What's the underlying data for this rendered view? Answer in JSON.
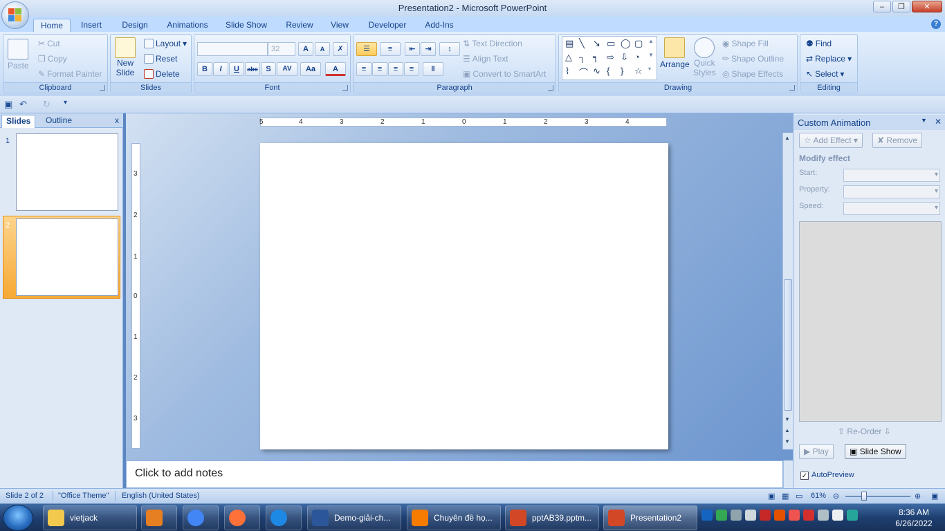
{
  "window": {
    "title": "Presentation2 - Microsoft PowerPoint"
  },
  "tabs": [
    {
      "label": "Home",
      "active": true
    },
    {
      "label": "Insert"
    },
    {
      "label": "Design"
    },
    {
      "label": "Animations"
    },
    {
      "label": "Slide Show"
    },
    {
      "label": "Review"
    },
    {
      "label": "View"
    },
    {
      "label": "Developer"
    },
    {
      "label": "Add-Ins"
    }
  ],
  "ribbon": {
    "clipboard": {
      "label": "Clipboard",
      "paste": "Paste",
      "cut": "Cut",
      "copy": "Copy",
      "format_painter": "Format Painter"
    },
    "slides": {
      "label": "Slides",
      "new_slide_1": "New",
      "new_slide_2": "Slide",
      "layout": "Layout",
      "reset": "Reset",
      "delete": "Delete"
    },
    "font": {
      "label": "Font",
      "size": "32",
      "bold": "B",
      "italic": "I",
      "underline": "U",
      "strike": "abc",
      "shadow": "S",
      "spacing": "AV",
      "case": "Aa",
      "color": "A"
    },
    "paragraph": {
      "label": "Paragraph",
      "text_direction": "Text Direction",
      "align_text": "Align Text",
      "convert_smartart": "Convert to SmartArt"
    },
    "drawing": {
      "label": "Drawing",
      "arrange": "Arrange",
      "quick_styles_1": "Quick",
      "quick_styles_2": "Styles",
      "shape_fill": "Shape Fill",
      "shape_outline": "Shape Outline",
      "shape_effects": "Shape Effects"
    },
    "editing": {
      "label": "Editing",
      "find": "Find",
      "replace": "Replace",
      "select": "Select"
    }
  },
  "left_pane": {
    "tabs": [
      "Slides",
      "Outline"
    ],
    "close": "x",
    "slides": [
      {
        "number": "1"
      },
      {
        "number": "2",
        "selected": true
      }
    ]
  },
  "ruler": {
    "horizontal": [
      "5",
      "4",
      "3",
      "2",
      "1",
      "0",
      "1",
      "2",
      "3",
      "4"
    ],
    "vertical": [
      "3",
      "2",
      "1",
      "0",
      "1",
      "2",
      "3"
    ]
  },
  "notes": {
    "placeholder": "Click to add notes"
  },
  "custom_animation": {
    "title": "Custom Animation",
    "add_effect": "Add Effect",
    "remove": "Remove",
    "modify_effect": "Modify effect",
    "start": "Start:",
    "property": "Property:",
    "speed": "Speed:",
    "reorder": "Re-Order",
    "play": "Play",
    "slide_show": "Slide Show",
    "autopreview": "AutoPreview",
    "autopreview_checked": true
  },
  "status": {
    "slide": "Slide 2 of 2",
    "theme": "\"Office Theme\"",
    "language": "English (United States)",
    "zoom": "61%"
  },
  "taskbar": {
    "items": [
      {
        "label": "vietjack",
        "color": "#f2c94c"
      },
      {
        "label": "",
        "color": "#e67e22"
      },
      {
        "label": "",
        "color": "#4285f4"
      },
      {
        "label": "",
        "color": "#ff7139"
      },
      {
        "label": "",
        "color": "#1e88e5"
      },
      {
        "label": "Demo-giải-ch...",
        "color": "#2b579a"
      },
      {
        "label": "Chuyên đề họ...",
        "color": "#f57c00"
      },
      {
        "label": "pptAB39.pptm...",
        "color": "#d24726"
      },
      {
        "label": "Presentation2",
        "color": "#d24726"
      }
    ],
    "time": "8:36 AM",
    "date": "6/26/2022"
  },
  "colors": {
    "ribbon_bg": "#dbe8f9",
    "accent": "#15428b",
    "selection": "#f7a935"
  }
}
